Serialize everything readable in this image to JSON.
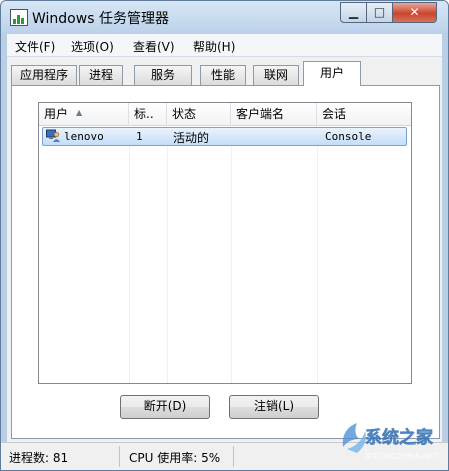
{
  "window": {
    "title": "Windows 任务管理器"
  },
  "caption_buttons": {
    "minimize": "▁",
    "maximize": "□",
    "close": "✕"
  },
  "menu": [
    {
      "label": "文件(F)"
    },
    {
      "label": "选项(O)"
    },
    {
      "label": "查看(V)"
    },
    {
      "label": "帮助(H)"
    }
  ],
  "tabs": [
    {
      "label": "应用程序"
    },
    {
      "label": "进程"
    },
    {
      "label": "服务"
    },
    {
      "label": "性能"
    },
    {
      "label": "联网"
    },
    {
      "label": "用户",
      "active": true
    }
  ],
  "users_table": {
    "columns": [
      "用户",
      "标..",
      "状态",
      "客户端名",
      "会话"
    ],
    "sorted_column": "用户",
    "rows": [
      {
        "user": "lenovo",
        "id": "1",
        "status": "活动的",
        "client": "",
        "session": "Console",
        "selected": true
      }
    ]
  },
  "buttons": {
    "disconnect": "断开(D)",
    "logoff": "注销(L)"
  },
  "status_bar": {
    "processes": "进程数: 81",
    "cpu": "CPU 使用率: 5%"
  },
  "watermark": {
    "text": "系统之家",
    "url": "XITONGZHIJIA.NET"
  },
  "colors": {
    "title_bar": "#c9dcef",
    "close_button": "#c9462c",
    "selection": "#c4ddf7"
  }
}
